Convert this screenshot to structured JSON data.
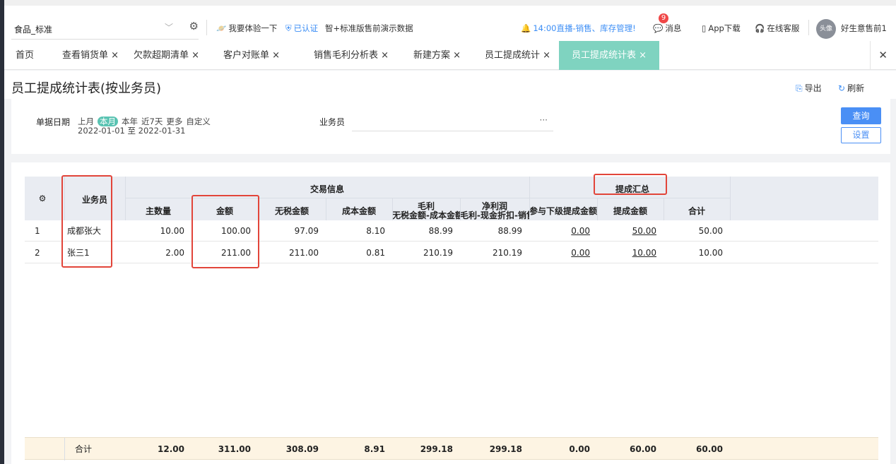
{
  "header": {
    "account_name": "食品_标准",
    "try_link": "我要体验一下",
    "verified": "已认证",
    "edition": "智+标准版售前演示数据",
    "live_notice": "14:00直播-销售、库存管理!",
    "messages_label": "消息",
    "messages_badge": "9",
    "app_download": "App下载",
    "service": "在线客服",
    "user_name": "好生意售前1",
    "avatar_text": "头像"
  },
  "tabs": [
    {
      "label": "首页"
    },
    {
      "label": "查看销货单 ×"
    },
    {
      "label": "欠款超期清单 ×"
    },
    {
      "label": "客户对账单 ×"
    },
    {
      "label": "销售毛利分析表 ×"
    },
    {
      "label": "新建方案 ×"
    },
    {
      "label": "员工提成统计 ×"
    },
    {
      "label": "员工提成统计表 ×"
    }
  ],
  "page": {
    "title": "员工提成统计表(按业务员)",
    "export": "导出",
    "refresh": "刷新"
  },
  "filter": {
    "date_label": "单据日期",
    "options": [
      "上月",
      "本月",
      "本年",
      "近7天",
      "更多",
      "自定义"
    ],
    "selected": "本月",
    "range": "2022-01-01 至 2022-01-31",
    "salesman_label": "业务员",
    "salesman_value": "",
    "more_dots": "···",
    "query": "查询",
    "settings": "设置"
  },
  "table": {
    "group_trade": "交易信息",
    "group_commission": "提成汇总",
    "col_salesman": "业务员",
    "cols": {
      "qty": "主数量",
      "amount": "金额",
      "taxfree": "无税金额",
      "cost": "成本金额",
      "gross": "毛利",
      "gross_sub": "无税金额-成本金额",
      "net": "净利润",
      "net_sub": "毛利-现金折扣-销售费用",
      "sub_commission": "参与下级提成金额",
      "commission": "提成金额",
      "total": "合计"
    },
    "rows": [
      {
        "idx": "1",
        "salesman": "成都张大",
        "qty": "10.00",
        "amount": "100.00",
        "taxfree": "97.09",
        "cost": "8.10",
        "gross": "88.99",
        "net": "88.99",
        "sub_commission": "0.00",
        "commission": "50.00",
        "total": "50.00"
      },
      {
        "idx": "2",
        "salesman": "张三1",
        "qty": "2.00",
        "amount": "211.00",
        "taxfree": "211.00",
        "cost": "0.81",
        "gross": "210.19",
        "net": "210.19",
        "sub_commission": "0.00",
        "commission": "10.00",
        "total": "10.00"
      }
    ],
    "totals": {
      "label": "合计",
      "qty": "12.00",
      "amount": "311.00",
      "taxfree": "308.09",
      "cost": "8.91",
      "gross": "299.18",
      "net": "299.18",
      "sub_commission": "0.00",
      "commission": "60.00",
      "total": "60.00"
    }
  },
  "colors": {
    "accent": "#4a8ff5",
    "active_tab": "#7fd3c0",
    "highlight": "#e2453a",
    "total_row": "#fdf4e3"
  }
}
